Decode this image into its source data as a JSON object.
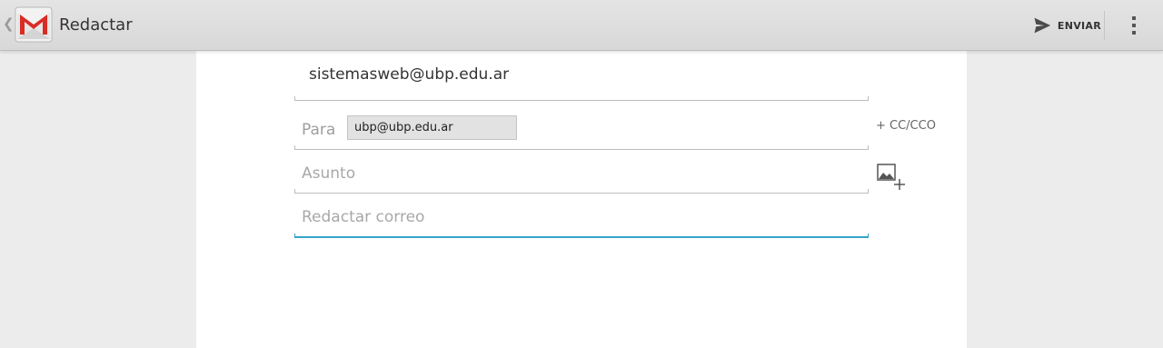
{
  "actionbar": {
    "title": "Redactar",
    "up_icon": "chevron-left-icon",
    "app_icon": "gmail-icon",
    "send_label": "ENVIAR",
    "send_icon": "send-icon",
    "overflow_icon": "more-vert-icon"
  },
  "compose": {
    "from": "sistemasweb@ubp.edu.ar",
    "to_label": "Para",
    "recipients": [
      "ubp@ubp.edu.ar"
    ],
    "cc_label": "+ CC/CCO",
    "subject_placeholder": "Asunto",
    "subject_value": "",
    "body_placeholder": "Redactar correo",
    "body_value": "",
    "attach_icon": "add-photo-icon"
  },
  "colors": {
    "accent": "#33a5c9",
    "gmail_red": "#d92c25"
  }
}
